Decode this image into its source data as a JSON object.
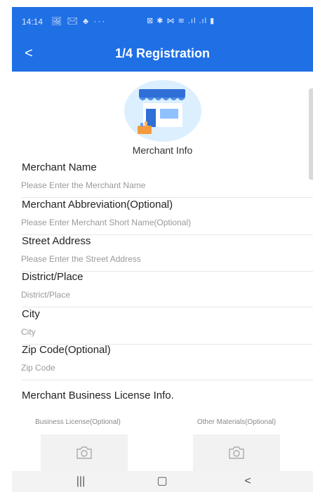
{
  "status_bar": {
    "time": "14:14",
    "left_icons": "🖼 ✉ ♣ ···",
    "right_icons": "⊠ ✱ ⋈ ≋ .ıl .ıl ▮"
  },
  "header": {
    "back_glyph": "<",
    "title": "1/4 Registration"
  },
  "section_title": "Merchant Info",
  "fields": [
    {
      "label": "Merchant Name",
      "placeholder": "Please Enter the Merchant Name"
    },
    {
      "label": "Merchant Abbreviation(Optional)",
      "placeholder": "Please Enter Merchant Short Name(Optional)"
    },
    {
      "label": "Street Address",
      "placeholder": "Please Enter the Street Address"
    },
    {
      "label": "District/Place",
      "placeholder": "District/Place"
    },
    {
      "label": "City",
      "placeholder": "City"
    },
    {
      "label": "Zip Code(Optional)",
      "placeholder": "Zip Code"
    }
  ],
  "license": {
    "title": "Merchant Business License Info.",
    "uploads": [
      {
        "caption": "Business License(Optional)"
      },
      {
        "caption": "Other Materials(Optional)"
      }
    ]
  },
  "nav_bar": {
    "recent": "|||",
    "home": "▢",
    "back": "<"
  },
  "colors": {
    "primary": "#1f6fe5",
    "upload_bg": "#f2f2f2"
  },
  "icons": [
    "back-icon",
    "shop-illustration",
    "camera-icon",
    "recent-apps-icon",
    "home-icon",
    "nav-back-icon"
  ]
}
